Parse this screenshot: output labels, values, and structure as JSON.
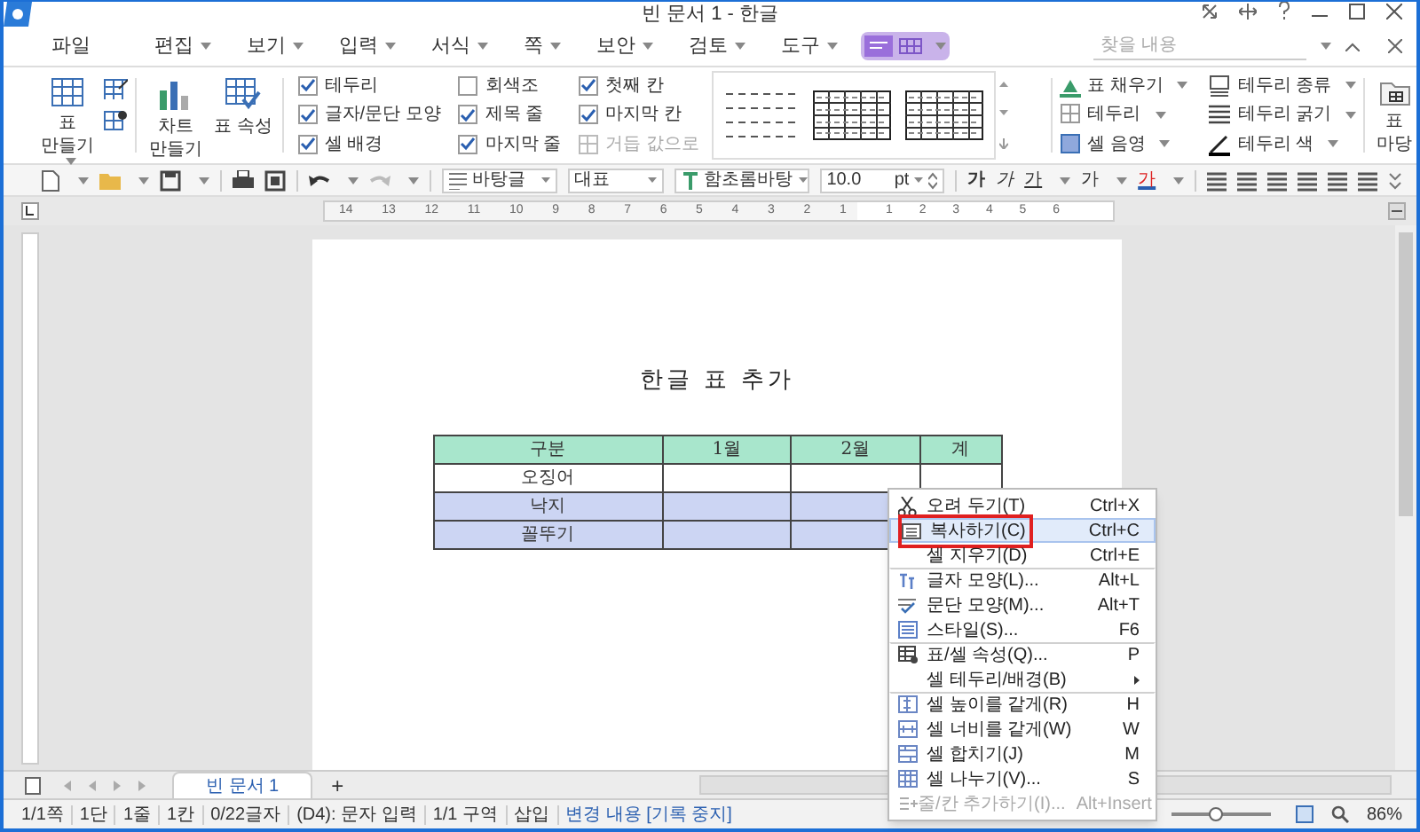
{
  "window": {
    "title": "빈 문서 1 - 한글"
  },
  "menu": [
    {
      "label": "파일",
      "dropdown": false
    },
    {
      "label": "편집",
      "dropdown": true
    },
    {
      "label": "보기",
      "dropdown": true
    },
    {
      "label": "입력",
      "dropdown": true
    },
    {
      "label": "서식",
      "dropdown": true
    },
    {
      "label": "쪽",
      "dropdown": true
    },
    {
      "label": "보안",
      "dropdown": true
    },
    {
      "label": "검토",
      "dropdown": true
    },
    {
      "label": "도구",
      "dropdown": true
    }
  ],
  "search": {
    "placeholder": "찾을 내용"
  },
  "ribbon": {
    "big_buttons": [
      {
        "label": "표 만들기",
        "dropdown": true
      },
      {
        "label": "차트 만들기",
        "dropdown": false
      },
      {
        "label": "표 속성",
        "dropdown": false
      }
    ],
    "options": [
      {
        "kind": "checkbox",
        "label": "테두리",
        "checked": true
      },
      {
        "kind": "checkbox",
        "label": "글자/문단 모양",
        "checked": true
      },
      {
        "kind": "checkbox",
        "label": "셀 배경",
        "checked": true
      },
      {
        "kind": "checkbox",
        "label": "회색조",
        "checked": false
      },
      {
        "kind": "checkbox",
        "label": "제목 줄",
        "checked": true
      },
      {
        "kind": "checkbox",
        "label": "마지막 줄",
        "checked": true
      },
      {
        "kind": "checkbox",
        "label": "첫째 칸",
        "checked": true
      },
      {
        "kind": "checkbox",
        "label": "마지막 칸",
        "checked": true
      },
      {
        "kind": "action",
        "label": "거듭 값으로",
        "checked": false
      }
    ],
    "format_buttons": [
      {
        "label": "표 채우기"
      },
      {
        "label": "테두리"
      },
      {
        "label": "셀 음영"
      },
      {
        "label": "테두리 종류"
      },
      {
        "label": "테두리 굵기"
      },
      {
        "label": "테두리 색"
      }
    ],
    "gallery_button": {
      "label": "표 마당"
    }
  },
  "toolbar": {
    "style": "바탕글",
    "outline": "대표",
    "font": "함초롬바탕",
    "size": "10.0",
    "unit": "pt",
    "char_buttons": [
      "가",
      "가",
      "가",
      "가",
      "가"
    ]
  },
  "ruler": {
    "left_numbers": [
      "14",
      "13",
      "12",
      "11",
      "10",
      "9",
      "8",
      "7",
      "6",
      "5",
      "4",
      "3",
      "2",
      "1"
    ],
    "right_numbers": [
      "1",
      "2",
      "3",
      "4",
      "5",
      "6"
    ]
  },
  "document": {
    "heading": "한글 표 추가",
    "table": {
      "columns": [
        "구분",
        "1월",
        "2월",
        "계"
      ],
      "rows": [
        {
          "cells": [
            "오징어",
            "",
            "",
            ""
          ],
          "selected": false
        },
        {
          "cells": [
            "낙지",
            "",
            "",
            ""
          ],
          "selected": true
        },
        {
          "cells": [
            "꼴뚜기",
            "",
            "",
            ""
          ],
          "selected": true
        }
      ]
    }
  },
  "context_menu": [
    {
      "kind": "icon",
      "label": "오려 두기(T)",
      "shortcut": "Ctrl+X",
      "highlighted": false,
      "disabled": false,
      "submenu": false,
      "separator_before": false
    },
    {
      "kind": "icon",
      "label": "복사하기(C)",
      "shortcut": "Ctrl+C",
      "highlighted": true,
      "disabled": false,
      "submenu": false,
      "separator_before": false
    },
    {
      "kind": "plain",
      "label": "셀 지우기(D)",
      "shortcut": "Ctrl+E",
      "highlighted": false,
      "disabled": false,
      "submenu": false,
      "separator_before": false
    },
    {
      "kind": "icon",
      "label": "글자 모양(L)...",
      "shortcut": "Alt+L",
      "highlighted": false,
      "disabled": false,
      "submenu": false,
      "separator_before": true
    },
    {
      "kind": "icon",
      "label": "문단 모양(M)...",
      "shortcut": "Alt+T",
      "highlighted": false,
      "disabled": false,
      "submenu": false,
      "separator_before": false
    },
    {
      "kind": "icon",
      "label": "스타일(S)...",
      "shortcut": "F6",
      "highlighted": false,
      "disabled": false,
      "submenu": false,
      "separator_before": false
    },
    {
      "kind": "icon",
      "label": "표/셀 속성(Q)...",
      "shortcut": "P",
      "highlighted": false,
      "disabled": false,
      "submenu": false,
      "separator_before": true
    },
    {
      "kind": "plain",
      "label": "셀 테두리/배경(B)",
      "highlighted": false,
      "disabled": false,
      "submenu": true,
      "separator_before": false
    },
    {
      "kind": "icon",
      "label": "셀 높이를 같게(R)",
      "shortcut": "H",
      "highlighted": false,
      "disabled": false,
      "submenu": false,
      "separator_before": true
    },
    {
      "kind": "icon",
      "label": "셀 너비를 같게(W)",
      "shortcut": "W",
      "highlighted": false,
      "disabled": false,
      "submenu": false,
      "separator_before": false
    },
    {
      "kind": "icon",
      "label": "셀 합치기(J)",
      "shortcut": "M",
      "highlighted": false,
      "disabled": false,
      "submenu": false,
      "separator_before": false
    },
    {
      "kind": "icon",
      "label": "셀 나누기(V)...",
      "shortcut": "S",
      "highlighted": false,
      "disabled": false,
      "submenu": false,
      "separator_before": false
    },
    {
      "kind": "icon",
      "label": "줄/칸 추가하기(I)...",
      "shortcut": "Alt+Insert",
      "highlighted": false,
      "disabled": true,
      "submenu": false,
      "separator_before": false
    }
  ],
  "doc_tabs": [
    {
      "label": "빈 문서 1",
      "selected": true
    }
  ],
  "new_tab": "+",
  "status_bar": [
    {
      "kind": "text",
      "label": "1/1쪽"
    },
    {
      "kind": "text",
      "label": "1단"
    },
    {
      "kind": "text",
      "label": "1줄"
    },
    {
      "kind": "text",
      "label": "1칸"
    },
    {
      "kind": "text",
      "label": "0/22글자"
    },
    {
      "kind": "text",
      "label": "(D4): 문자 입력"
    },
    {
      "kind": "text",
      "label": "1/1 구역"
    },
    {
      "kind": "text",
      "label": "삽입"
    },
    {
      "kind": "link",
      "label": "변경 내용 [기록 중지]"
    }
  ],
  "zoom": {
    "level": 0.45,
    "reading": "86%"
  }
}
